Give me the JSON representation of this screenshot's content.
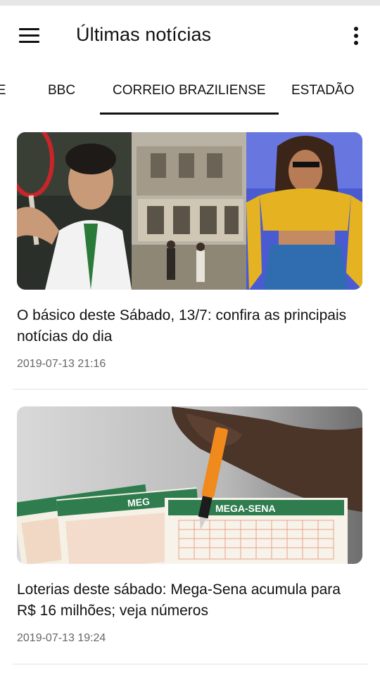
{
  "app_bar": {
    "title": "Últimas notícias",
    "menu_icon": "menu-icon",
    "more_icon": "more-vert-icon"
  },
  "tabs": [
    {
      "label": "DE"
    },
    {
      "label": "BBC"
    },
    {
      "label": "CORREIO BRAZILIENSE",
      "selected": true
    },
    {
      "label": "ESTADÃO"
    }
  ],
  "articles": [
    {
      "headline": "O básico deste Sábado, 13/7: confira as principais notícias do dia",
      "timestamp": "2019-07-13 21:16"
    },
    {
      "headline": "Loterias deste sábado: Mega-Sena acumula para R$ 16 milhões; veja números",
      "timestamp": "2019-07-13 19:24",
      "image_text": {
        "brand_1": "MEGA-SENA",
        "brand_2": "MEG"
      }
    }
  ],
  "colors": {
    "accent": "#111111",
    "timestamp": "#666666",
    "lottery_green": "#2f7d4e"
  }
}
